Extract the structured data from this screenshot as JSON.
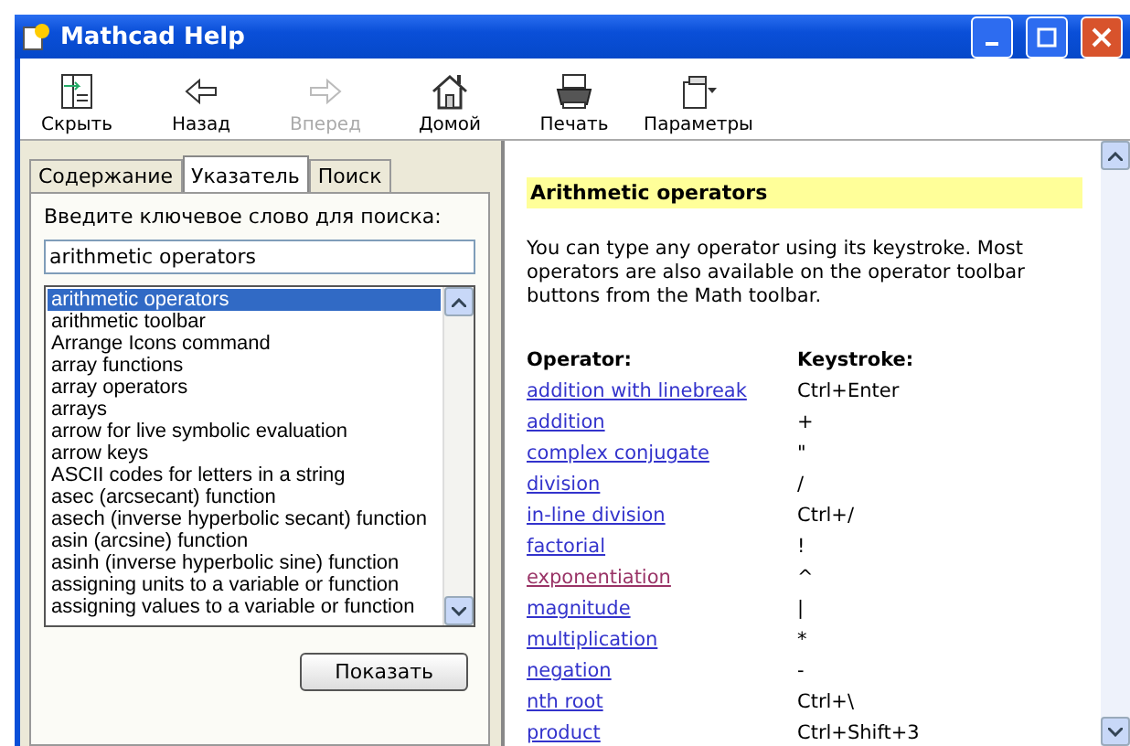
{
  "window": {
    "title": "Mathcad Help"
  },
  "toolbar": [
    {
      "label": "Скрыть",
      "disabled": false
    },
    {
      "label": "Назад",
      "disabled": false
    },
    {
      "label": "Вперед",
      "disabled": true
    },
    {
      "label": "Домой",
      "disabled": false
    },
    {
      "label": "Печать",
      "disabled": false
    },
    {
      "label": "Параметры",
      "disabled": false
    }
  ],
  "tabs": [
    {
      "label": "Содержание",
      "selected": false
    },
    {
      "label": "Указатель",
      "selected": true
    },
    {
      "label": "Поиск",
      "selected": false
    }
  ],
  "search": {
    "label": "Введите ключевое слово для поиска:",
    "value": "arithmetic operators"
  },
  "index_items": [
    {
      "label": "arithmetic operators",
      "selected": true
    },
    {
      "label": "arithmetic toolbar",
      "selected": false
    },
    {
      "label": "Arrange Icons command",
      "selected": false
    },
    {
      "label": "array functions",
      "selected": false
    },
    {
      "label": "array operators",
      "selected": false
    },
    {
      "label": "arrays",
      "selected": false
    },
    {
      "label": "arrow for live symbolic evaluation",
      "selected": false
    },
    {
      "label": "arrow keys",
      "selected": false
    },
    {
      "label": "ASCII codes for letters in a string",
      "selected": false
    },
    {
      "label": "asec (arcsecant) function",
      "selected": false
    },
    {
      "label": "asech (inverse hyperbolic secant) function",
      "selected": false
    },
    {
      "label": "asin (arcsine) function",
      "selected": false
    },
    {
      "label": "asinh (inverse hyperbolic sine) function",
      "selected": false
    },
    {
      "label": "assigning units to a variable or function",
      "selected": false
    },
    {
      "label": "assigning values to a variable or function",
      "selected": false
    }
  ],
  "show_button": "Показать",
  "topic": {
    "heading": "Arithmetic operators",
    "intro": "You can type any operator using its keystroke. Most operators are also available on the operator toolbar buttons from the Math toolbar.",
    "columns": [
      "Operator:",
      "Keystroke:"
    ],
    "rows": [
      {
        "operator": "addition with linebreak",
        "keystroke": "Ctrl+Enter",
        "visited": false
      },
      {
        "operator": "addition",
        "keystroke": "+",
        "visited": false
      },
      {
        "operator": "complex conjugate",
        "keystroke": "\"",
        "visited": false
      },
      {
        "operator": "division",
        "keystroke": "/",
        "visited": false
      },
      {
        "operator": "in-line division",
        "keystroke": "Ctrl+/",
        "visited": false
      },
      {
        "operator": "factorial",
        "keystroke": "!",
        "visited": false
      },
      {
        "operator": "exponentiation",
        "keystroke": "^",
        "visited": true
      },
      {
        "operator": "magnitude",
        "keystroke": "|",
        "visited": false
      },
      {
        "operator": "multiplication",
        "keystroke": "*",
        "visited": false
      },
      {
        "operator": "negation",
        "keystroke": "-",
        "visited": false
      },
      {
        "operator": "nth root",
        "keystroke": "Ctrl+\\",
        "visited": false
      },
      {
        "operator": "product",
        "keystroke": "Ctrl+Shift+3",
        "visited": false
      }
    ]
  }
}
